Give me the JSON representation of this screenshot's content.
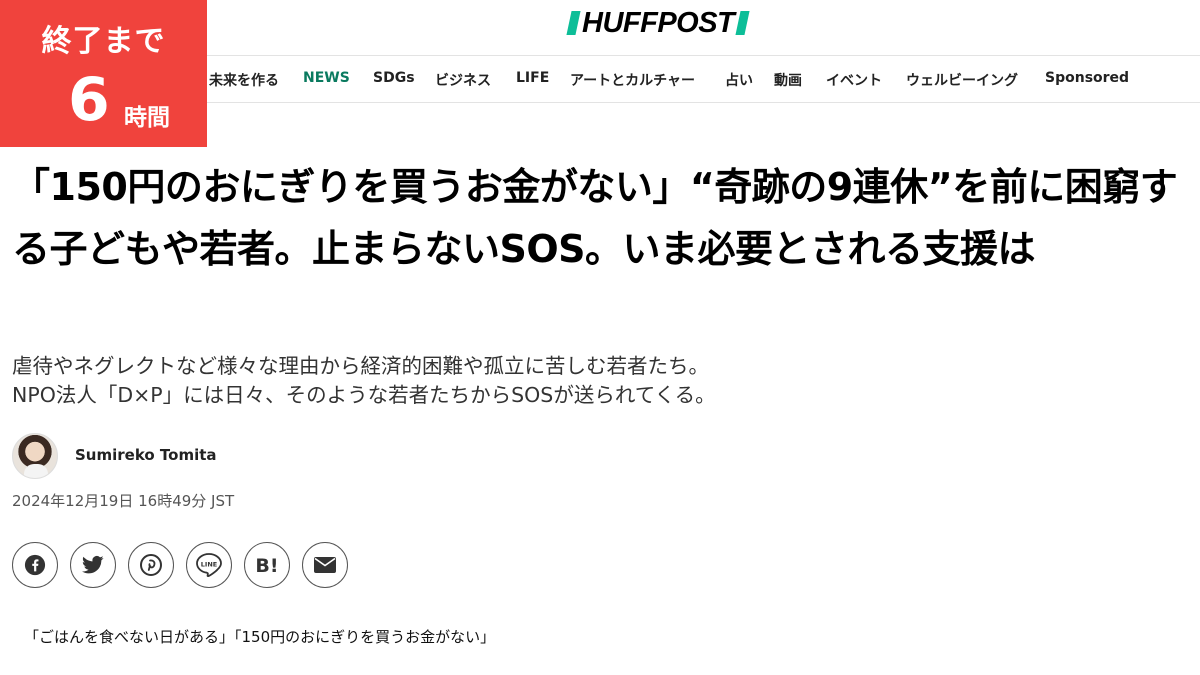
{
  "countdown": {
    "label": "終了まで",
    "number": "6",
    "unit": "時間"
  },
  "logo": {
    "text": "HUFFPOST"
  },
  "nav": {
    "items": [
      {
        "label": "未来を作る",
        "active": false
      },
      {
        "label": "NEWS",
        "active": true
      },
      {
        "label": "SDGs",
        "active": false
      },
      {
        "label": "ビジネス",
        "active": false
      },
      {
        "label": "LIFE",
        "active": false
      },
      {
        "label": "アートとカルチャー",
        "active": false
      },
      {
        "label": "占い",
        "active": false
      },
      {
        "label": "動画",
        "active": false
      },
      {
        "label": "イベント",
        "active": false
      },
      {
        "label": "ウェルビーイング",
        "active": false
      },
      {
        "label": "Sponsored",
        "active": false
      }
    ]
  },
  "article": {
    "headline": "「150円のおにぎりを買うお金がない」“奇跡の9連休”を前に困窮する子どもや若者。止まらないSOS。いま必要とされる支援は",
    "dek_line1": "虐待やネグレクトなど様々な理由から経済的困難や孤立に苦しむ若者たち。",
    "dek_line2": "NPO法人「D×P」には日々、そのような若者たちからSOSが送られてくる。",
    "author": "Sumireko Tomita",
    "date": "2024年12月19日 16時49分 JST",
    "first_paragraph": "「ごはんを食べない日がある」「150円のおにぎりを買うお金がない」"
  },
  "share": {
    "buttons": [
      "facebook-icon",
      "twitter-icon",
      "pinterest-icon",
      "line-icon",
      "hatena-bookmark-icon",
      "email-icon"
    ],
    "line_label": "LINE",
    "hatena_label": "B!"
  },
  "colors": {
    "accent": "#0dbe98",
    "nav_active": "#0a7a5f",
    "badge": "#f0433d"
  }
}
